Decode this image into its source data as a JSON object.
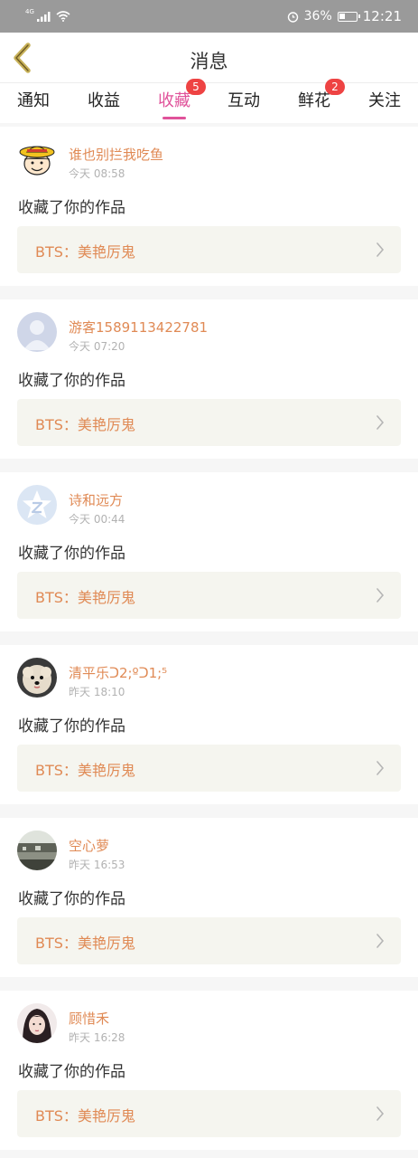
{
  "status_bar": {
    "network": "4G",
    "battery": "36%",
    "battery_level": 0.36,
    "time": "12:21"
  },
  "header": {
    "title": "消息"
  },
  "tabs": [
    {
      "label": "通知",
      "active": false,
      "badge": ""
    },
    {
      "label": "收益",
      "active": false,
      "badge": ""
    },
    {
      "label": "收藏",
      "active": true,
      "badge": "5"
    },
    {
      "label": "互动",
      "active": false,
      "badge": ""
    },
    {
      "label": "鲜花",
      "active": false,
      "badge": "2"
    },
    {
      "label": "关注",
      "active": false,
      "badge": ""
    }
  ],
  "colors": {
    "accent": "#e0529a",
    "username": "#e08a55",
    "badge": "#ee4343",
    "back_arrow": "#c8b25a"
  },
  "items": [
    {
      "username": "谁也别拦我吃鱼",
      "time": "今天 08:58",
      "action": "收藏了你的作品",
      "work": "BTS：美艳厉鬼",
      "avatar_icon": "cartoon-straw-hat-avatar-icon"
    },
    {
      "username": "游客1589113422781",
      "time": "今天 07:20",
      "action": "收藏了你的作品",
      "work": "BTS：美艳厉鬼",
      "avatar_icon": "default-user-avatar-icon"
    },
    {
      "username": "诗和远方",
      "time": "今天 00:44",
      "action": "收藏了你的作品",
      "work": "BTS：美艳厉鬼",
      "avatar_icon": "star-logo-avatar-icon"
    },
    {
      "username": "清平乐ᑐ2;ºᑐ1;⁵",
      "time": "昨天 18:10",
      "action": "收藏了你的作品",
      "work": "BTS：美艳厉鬼",
      "avatar_icon": "puppy-photo-avatar-icon"
    },
    {
      "username": "空心萝",
      "time": "昨天 16:53",
      "action": "收藏了你的作品",
      "work": "BTS：美艳厉鬼",
      "avatar_icon": "landscape-photo-avatar-icon"
    },
    {
      "username": "顾惜禾",
      "time": "昨天 16:28",
      "action": "收藏了你的作品",
      "work": "BTS：美艳厉鬼",
      "avatar_icon": "portrait-photo-avatar-icon"
    }
  ]
}
